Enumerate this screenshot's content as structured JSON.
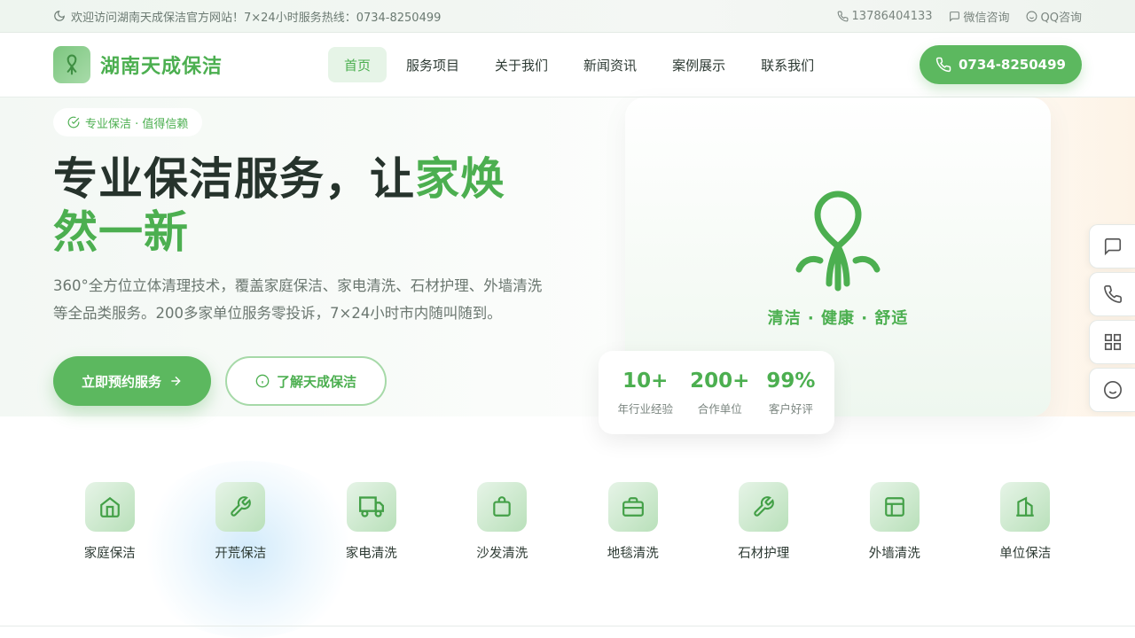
{
  "topbar": {
    "welcome": "欢迎访问湖南天成保洁官方网站！7×24小时服务热线：0734-8250499",
    "mobile": "13786404133",
    "wechat": "微信咨询",
    "qq": "QQ咨询"
  },
  "header": {
    "brand": "湖南天成保洁",
    "nav": [
      "首页",
      "服务项目",
      "关于我们",
      "新闻资讯",
      "案例展示",
      "联系我们"
    ],
    "active_nav": "首页",
    "hotline": "0734-8250499"
  },
  "hero": {
    "badge": "专业保洁 · 值得信赖",
    "title_main": "专业保洁服务，让",
    "title_highlight": "家焕然一新",
    "description": "360°全方位立体清理技术，覆盖家庭保洁、家电清洗、石材护理、外墙清洗等全品类服务。200多家单位服务零投诉，7×24小时市内随叫随到。",
    "btn_primary": "立即预约服务",
    "btn_secondary": "了解天成保洁",
    "card_slogan": "清洁 · 健康 · 舒适",
    "stats": [
      {
        "value": "10+",
        "label": "年行业经验"
      },
      {
        "value": "200+",
        "label": "合作单位"
      },
      {
        "value": "99%",
        "label": "客户好评"
      }
    ]
  },
  "services": [
    {
      "label": "家庭保洁",
      "icon": "home-icon"
    },
    {
      "label": "开荒保洁",
      "icon": "wrench-icon"
    },
    {
      "label": "家电清洗",
      "icon": "truck-icon"
    },
    {
      "label": "沙发清洗",
      "icon": "bag-icon"
    },
    {
      "label": "地毯清洗",
      "icon": "briefcase-icon"
    },
    {
      "label": "石材护理",
      "icon": "wrench-icon"
    },
    {
      "label": "外墙清洗",
      "icon": "layout-icon"
    },
    {
      "label": "单位保洁",
      "icon": "building-icon"
    }
  ],
  "colors": {
    "brand": "#4caf50",
    "button": "#5cb85f",
    "text": "#26332c"
  }
}
